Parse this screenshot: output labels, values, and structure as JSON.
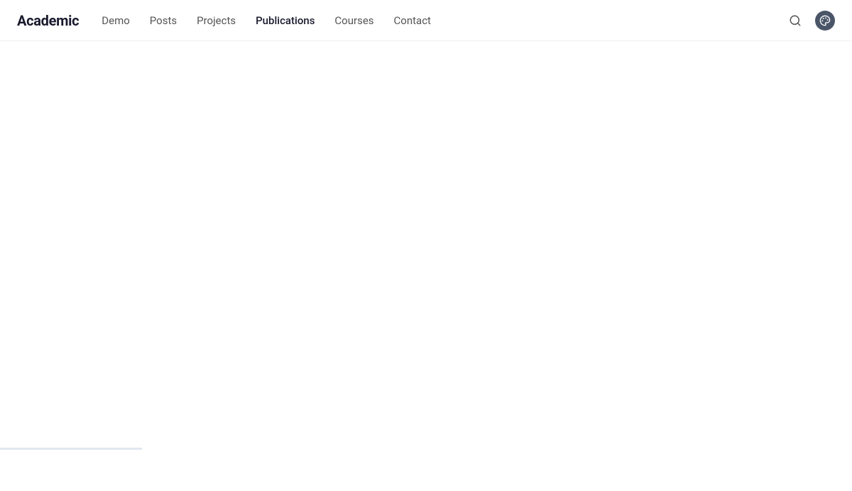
{
  "header": {
    "site_title": "Academic",
    "nav_items": [
      {
        "label": "Demo",
        "href": "#demo",
        "active": false
      },
      {
        "label": "Posts",
        "href": "#posts",
        "active": false
      },
      {
        "label": "Projects",
        "href": "#projects",
        "active": false
      },
      {
        "label": "Publications",
        "href": "#publications",
        "active": true
      },
      {
        "label": "Courses",
        "href": "#courses",
        "active": false
      },
      {
        "label": "Contact",
        "href": "#contact",
        "active": false
      }
    ],
    "search_tooltip": "Search",
    "palette_tooltip": "Display preferences"
  },
  "main": {
    "content": ""
  }
}
